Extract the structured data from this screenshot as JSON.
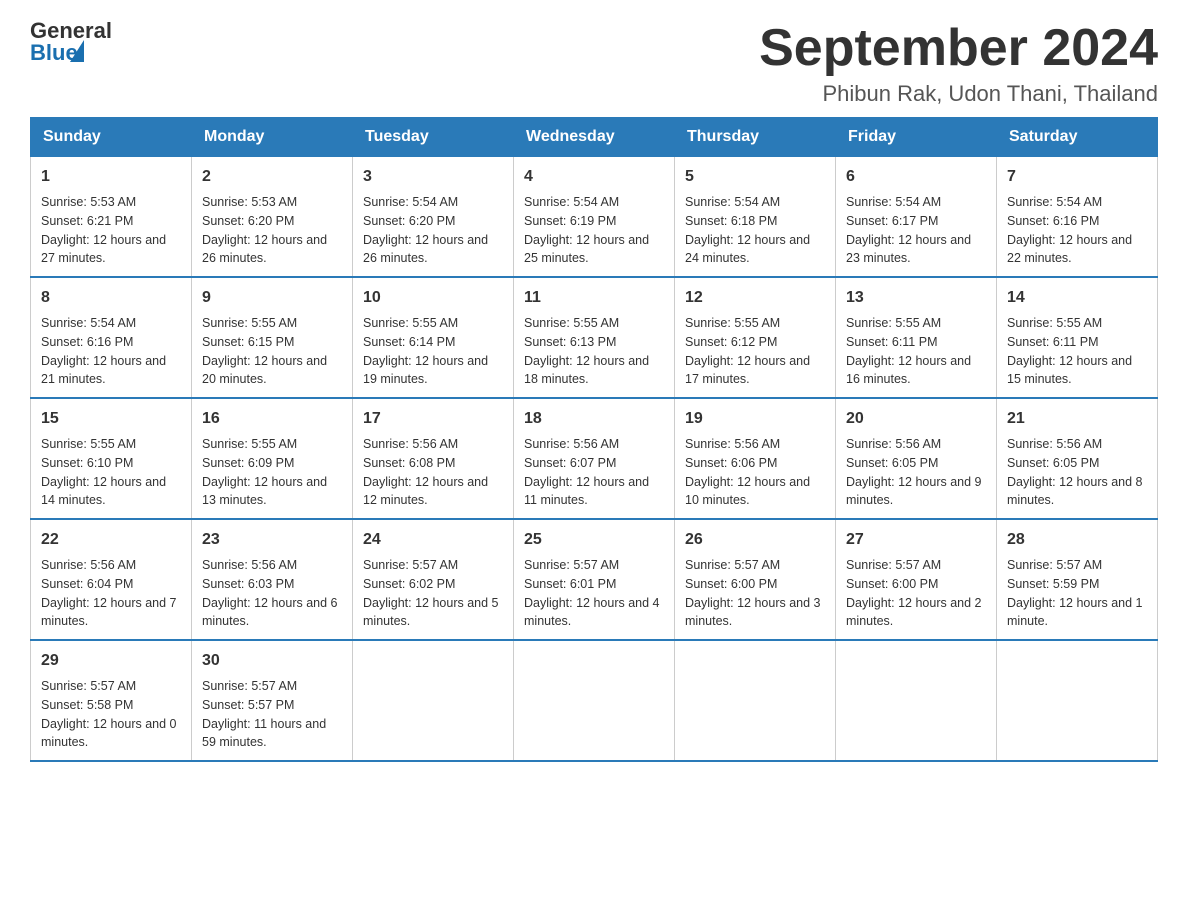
{
  "logo": {
    "general": "General",
    "blue": "Blue"
  },
  "header": {
    "title": "September 2024",
    "subtitle": "Phibun Rak, Udon Thani, Thailand"
  },
  "weekdays": [
    "Sunday",
    "Monday",
    "Tuesday",
    "Wednesday",
    "Thursday",
    "Friday",
    "Saturday"
  ],
  "weeks": [
    [
      {
        "day": "1",
        "sunrise": "5:53 AM",
        "sunset": "6:21 PM",
        "daylight": "12 hours and 27 minutes."
      },
      {
        "day": "2",
        "sunrise": "5:53 AM",
        "sunset": "6:20 PM",
        "daylight": "12 hours and 26 minutes."
      },
      {
        "day": "3",
        "sunrise": "5:54 AM",
        "sunset": "6:20 PM",
        "daylight": "12 hours and 26 minutes."
      },
      {
        "day": "4",
        "sunrise": "5:54 AM",
        "sunset": "6:19 PM",
        "daylight": "12 hours and 25 minutes."
      },
      {
        "day": "5",
        "sunrise": "5:54 AM",
        "sunset": "6:18 PM",
        "daylight": "12 hours and 24 minutes."
      },
      {
        "day": "6",
        "sunrise": "5:54 AM",
        "sunset": "6:17 PM",
        "daylight": "12 hours and 23 minutes."
      },
      {
        "day": "7",
        "sunrise": "5:54 AM",
        "sunset": "6:16 PM",
        "daylight": "12 hours and 22 minutes."
      }
    ],
    [
      {
        "day": "8",
        "sunrise": "5:54 AM",
        "sunset": "6:16 PM",
        "daylight": "12 hours and 21 minutes."
      },
      {
        "day": "9",
        "sunrise": "5:55 AM",
        "sunset": "6:15 PM",
        "daylight": "12 hours and 20 minutes."
      },
      {
        "day": "10",
        "sunrise": "5:55 AM",
        "sunset": "6:14 PM",
        "daylight": "12 hours and 19 minutes."
      },
      {
        "day": "11",
        "sunrise": "5:55 AM",
        "sunset": "6:13 PM",
        "daylight": "12 hours and 18 minutes."
      },
      {
        "day": "12",
        "sunrise": "5:55 AM",
        "sunset": "6:12 PM",
        "daylight": "12 hours and 17 minutes."
      },
      {
        "day": "13",
        "sunrise": "5:55 AM",
        "sunset": "6:11 PM",
        "daylight": "12 hours and 16 minutes."
      },
      {
        "day": "14",
        "sunrise": "5:55 AM",
        "sunset": "6:11 PM",
        "daylight": "12 hours and 15 minutes."
      }
    ],
    [
      {
        "day": "15",
        "sunrise": "5:55 AM",
        "sunset": "6:10 PM",
        "daylight": "12 hours and 14 minutes."
      },
      {
        "day": "16",
        "sunrise": "5:55 AM",
        "sunset": "6:09 PM",
        "daylight": "12 hours and 13 minutes."
      },
      {
        "day": "17",
        "sunrise": "5:56 AM",
        "sunset": "6:08 PM",
        "daylight": "12 hours and 12 minutes."
      },
      {
        "day": "18",
        "sunrise": "5:56 AM",
        "sunset": "6:07 PM",
        "daylight": "12 hours and 11 minutes."
      },
      {
        "day": "19",
        "sunrise": "5:56 AM",
        "sunset": "6:06 PM",
        "daylight": "12 hours and 10 minutes."
      },
      {
        "day": "20",
        "sunrise": "5:56 AM",
        "sunset": "6:05 PM",
        "daylight": "12 hours and 9 minutes."
      },
      {
        "day": "21",
        "sunrise": "5:56 AM",
        "sunset": "6:05 PM",
        "daylight": "12 hours and 8 minutes."
      }
    ],
    [
      {
        "day": "22",
        "sunrise": "5:56 AM",
        "sunset": "6:04 PM",
        "daylight": "12 hours and 7 minutes."
      },
      {
        "day": "23",
        "sunrise": "5:56 AM",
        "sunset": "6:03 PM",
        "daylight": "12 hours and 6 minutes."
      },
      {
        "day": "24",
        "sunrise": "5:57 AM",
        "sunset": "6:02 PM",
        "daylight": "12 hours and 5 minutes."
      },
      {
        "day": "25",
        "sunrise": "5:57 AM",
        "sunset": "6:01 PM",
        "daylight": "12 hours and 4 minutes."
      },
      {
        "day": "26",
        "sunrise": "5:57 AM",
        "sunset": "6:00 PM",
        "daylight": "12 hours and 3 minutes."
      },
      {
        "day": "27",
        "sunrise": "5:57 AM",
        "sunset": "6:00 PM",
        "daylight": "12 hours and 2 minutes."
      },
      {
        "day": "28",
        "sunrise": "5:57 AM",
        "sunset": "5:59 PM",
        "daylight": "12 hours and 1 minute."
      }
    ],
    [
      {
        "day": "29",
        "sunrise": "5:57 AM",
        "sunset": "5:58 PM",
        "daylight": "12 hours and 0 minutes."
      },
      {
        "day": "30",
        "sunrise": "5:57 AM",
        "sunset": "5:57 PM",
        "daylight": "11 hours and 59 minutes."
      },
      null,
      null,
      null,
      null,
      null
    ]
  ],
  "labels": {
    "sunrise": "Sunrise: ",
    "sunset": "Sunset: ",
    "daylight": "Daylight: "
  }
}
